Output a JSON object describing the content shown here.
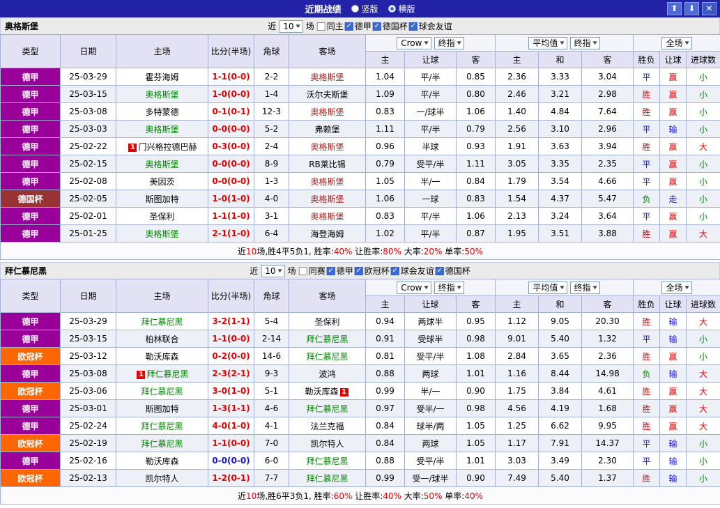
{
  "icons": {
    "dropdown_arrow": "▼",
    "check": "✓",
    "up_arrow": "⬆",
    "down_arrow": "⬇",
    "close": "✕"
  },
  "colors": {
    "red": "#e60000",
    "green": "#008800",
    "blue": "#1414cc",
    "black": "#000000",
    "team_red": "#aa2222",
    "team_green": "#008800"
  },
  "titlebar": {
    "title": "近期战绩",
    "layout_vertical": "竖版",
    "layout_horizontal": "横版",
    "selected_layout": "横版"
  },
  "table_headers": {
    "type": "类型",
    "date": "日期",
    "home": "主场",
    "score": "比分(半场)",
    "corner": "角球",
    "away": "客场",
    "odds_home": "主",
    "odds_handicap": "让球",
    "odds_away": "客",
    "avg_home": "主",
    "avg_draw": "和",
    "avg_away": "客",
    "result": "胜负",
    "handicap_result": "让球",
    "goals": "进球数"
  },
  "sections": [
    {
      "team": "奥格斯堡",
      "filter": {
        "near": "近",
        "count": "10",
        "unit": "场",
        "checkboxes": [
          {
            "label": "同主",
            "checked": false
          },
          {
            "label": "德甲",
            "checked": true
          },
          {
            "label": "德国杯",
            "checked": true
          },
          {
            "label": "球会友谊",
            "checked": true
          }
        ]
      },
      "dropdowns": {
        "company": "Crow",
        "company_time": "终指",
        "avg": "平均值",
        "avg_time": "终指",
        "scope": "全场"
      },
      "rows": [
        {
          "league": "德甲",
          "league_bg": "#990099",
          "date": "25-03-29",
          "home": "霍芬海姆",
          "home_color": "black",
          "home_badge": "",
          "score": "1-1(0-0)",
          "score_color": "red",
          "corner": "2-2",
          "away": "奥格斯堡",
          "away_color": "team_red",
          "away_badge": "",
          "h_odds": "1.04",
          "handicap": "平/半",
          "a_odds": "0.85",
          "avg_h": "2.36",
          "avg_d": "3.33",
          "avg_a": "3.04",
          "result": "平",
          "result_color": "blue",
          "let_result": "赢",
          "let_color": "red",
          "goal": "小",
          "goal_color": "green"
        },
        {
          "league": "德甲",
          "league_bg": "#990099",
          "date": "25-03-15",
          "home": "奥格斯堡",
          "home_color": "team_green",
          "home_badge": "",
          "score": "1-0(0-0)",
          "score_color": "red",
          "corner": "1-4",
          "away": "沃尔夫斯堡",
          "away_color": "black",
          "away_badge": "",
          "h_odds": "1.09",
          "handicap": "平/半",
          "a_odds": "0.80",
          "avg_h": "2.46",
          "avg_d": "3.21",
          "avg_a": "2.98",
          "result": "胜",
          "result_color": "red",
          "let_result": "赢",
          "let_color": "red",
          "goal": "小",
          "goal_color": "green"
        },
        {
          "league": "德甲",
          "league_bg": "#990099",
          "date": "25-03-08",
          "home": "多特蒙德",
          "home_color": "black",
          "home_badge": "",
          "score": "0-1(0-1)",
          "score_color": "red",
          "corner": "12-3",
          "away": "奥格斯堡",
          "away_color": "team_red",
          "away_badge": "",
          "h_odds": "0.83",
          "handicap": "一/球半",
          "a_odds": "1.06",
          "avg_h": "1.40",
          "avg_d": "4.84",
          "avg_a": "7.64",
          "result": "胜",
          "result_color": "red",
          "let_result": "赢",
          "let_color": "red",
          "goal": "小",
          "goal_color": "green"
        },
        {
          "league": "德甲",
          "league_bg": "#990099",
          "date": "25-03-03",
          "home": "奥格斯堡",
          "home_color": "team_green",
          "home_badge": "",
          "score": "0-0(0-0)",
          "score_color": "red",
          "corner": "5-2",
          "away": "弗赖堡",
          "away_color": "black",
          "away_badge": "",
          "h_odds": "1.11",
          "handicap": "平/半",
          "a_odds": "0.79",
          "avg_h": "2.56",
          "avg_d": "3.10",
          "avg_a": "2.96",
          "result": "平",
          "result_color": "blue",
          "let_result": "输",
          "let_color": "blue",
          "goal": "小",
          "goal_color": "green"
        },
        {
          "league": "德甲",
          "league_bg": "#990099",
          "date": "25-02-22",
          "home": "门兴格拉德巴赫",
          "home_color": "black",
          "home_badge": "1",
          "score": "0-3(0-0)",
          "score_color": "red",
          "corner": "2-4",
          "away": "奥格斯堡",
          "away_color": "team_red",
          "away_badge": "",
          "h_odds": "0.96",
          "handicap": "半球",
          "a_odds": "0.93",
          "avg_h": "1.91",
          "avg_d": "3.63",
          "avg_a": "3.94",
          "result": "胜",
          "result_color": "red",
          "let_result": "赢",
          "let_color": "red",
          "goal": "大",
          "goal_color": "red"
        },
        {
          "league": "德甲",
          "league_bg": "#990099",
          "date": "25-02-15",
          "home": "奥格斯堡",
          "home_color": "team_green",
          "home_badge": "",
          "score": "0-0(0-0)",
          "score_color": "red",
          "corner": "8-9",
          "away": "RB莱比锡",
          "away_color": "black",
          "away_badge": "",
          "h_odds": "0.79",
          "handicap": "受平/半",
          "a_odds": "1.11",
          "avg_h": "3.05",
          "avg_d": "3.35",
          "avg_a": "2.35",
          "result": "平",
          "result_color": "blue",
          "let_result": "赢",
          "let_color": "red",
          "goal": "小",
          "goal_color": "green"
        },
        {
          "league": "德甲",
          "league_bg": "#990099",
          "date": "25-02-08",
          "home": "美因茨",
          "home_color": "black",
          "home_badge": "",
          "score": "0-0(0-0)",
          "score_color": "red",
          "corner": "1-3",
          "away": "奥格斯堡",
          "away_color": "team_red",
          "away_badge": "",
          "h_odds": "1.05",
          "handicap": "半/一",
          "a_odds": "0.84",
          "avg_h": "1.79",
          "avg_d": "3.54",
          "avg_a": "4.66",
          "result": "平",
          "result_color": "blue",
          "let_result": "赢",
          "let_color": "red",
          "goal": "小",
          "goal_color": "green"
        },
        {
          "league": "德国杯",
          "league_bg": "#993333",
          "date": "25-02-05",
          "home": "斯图加特",
          "home_color": "black",
          "home_badge": "",
          "score": "1-0(1-0)",
          "score_color": "red",
          "corner": "4-0",
          "away": "奥格斯堡",
          "away_color": "team_red",
          "away_badge": "",
          "h_odds": "1.06",
          "handicap": "一球",
          "a_odds": "0.83",
          "avg_h": "1.54",
          "avg_d": "4.37",
          "avg_a": "5.47",
          "result": "负",
          "result_color": "green",
          "let_result": "走",
          "let_color": "blue",
          "goal": "小",
          "goal_color": "green"
        },
        {
          "league": "德甲",
          "league_bg": "#990099",
          "date": "25-02-01",
          "home": "圣保利",
          "home_color": "black",
          "home_badge": "",
          "score": "1-1(1-0)",
          "score_color": "red",
          "corner": "3-1",
          "away": "奥格斯堡",
          "away_color": "team_red",
          "away_badge": "",
          "h_odds": "0.83",
          "handicap": "平/半",
          "a_odds": "1.06",
          "avg_h": "2.13",
          "avg_d": "3.24",
          "avg_a": "3.64",
          "result": "平",
          "result_color": "blue",
          "let_result": "赢",
          "let_color": "red",
          "goal": "小",
          "goal_color": "green"
        },
        {
          "league": "德甲",
          "league_bg": "#990099",
          "date": "25-01-25",
          "home": "奥格斯堡",
          "home_color": "team_green",
          "home_badge": "",
          "score": "2-1(1-0)",
          "score_color": "red",
          "corner": "6-4",
          "away": "海登海姆",
          "away_color": "black",
          "away_badge": "",
          "h_odds": "1.02",
          "handicap": "平/半",
          "a_odds": "0.87",
          "avg_h": "1.95",
          "avg_d": "3.51",
          "avg_a": "3.88",
          "result": "胜",
          "result_color": "red",
          "let_result": "赢",
          "let_color": "red",
          "goal": "大",
          "goal_color": "red"
        }
      ],
      "summary_segments": [
        {
          "text": "近",
          "color": "black"
        },
        {
          "text": "10",
          "color": "red"
        },
        {
          "text": "场,胜4平5负1, 胜率:",
          "color": "black"
        },
        {
          "text": "40%",
          "color": "red"
        },
        {
          "text": " 让胜率:",
          "color": "black"
        },
        {
          "text": "80%",
          "color": "red"
        },
        {
          "text": " 大率:",
          "color": "black"
        },
        {
          "text": "20%",
          "color": "red"
        },
        {
          "text": " 单率:",
          "color": "black"
        },
        {
          "text": "50%",
          "color": "red"
        }
      ]
    },
    {
      "team": "拜仁慕尼黑",
      "filter": {
        "near": "近",
        "count": "10",
        "unit": "场",
        "checkboxes": [
          {
            "label": "同赛",
            "checked": false
          },
          {
            "label": "德甲",
            "checked": true
          },
          {
            "label": "欧冠杯",
            "checked": true
          },
          {
            "label": "球会友谊",
            "checked": true
          },
          {
            "label": "德国杯",
            "checked": true
          }
        ]
      },
      "dropdowns": {
        "company": "Crow",
        "company_time": "终指",
        "avg": "平均值",
        "avg_time": "终指",
        "scope": "全场"
      },
      "rows": [
        {
          "league": "德甲",
          "league_bg": "#990099",
          "date": "25-03-29",
          "home": "拜仁慕尼黑",
          "home_color": "team_green",
          "home_badge": "",
          "score": "3-2(1-1)",
          "score_color": "red",
          "corner": "5-4",
          "away": "圣保利",
          "away_color": "black",
          "away_badge": "",
          "h_odds": "0.94",
          "handicap": "两球半",
          "a_odds": "0.95",
          "avg_h": "1.12",
          "avg_d": "9.05",
          "avg_a": "20.30",
          "result": "胜",
          "result_color": "red",
          "let_result": "输",
          "let_color": "blue",
          "goal": "大",
          "goal_color": "red"
        },
        {
          "league": "德甲",
          "league_bg": "#990099",
          "date": "25-03-15",
          "home": "柏林联合",
          "home_color": "black",
          "home_badge": "",
          "score": "1-1(0-0)",
          "score_color": "red",
          "corner": "2-14",
          "away": "拜仁慕尼黑",
          "away_color": "team_green",
          "away_badge": "",
          "h_odds": "0.91",
          "handicap": "受球半",
          "a_odds": "0.98",
          "avg_h": "9.01",
          "avg_d": "5.40",
          "avg_a": "1.32",
          "result": "平",
          "result_color": "blue",
          "let_result": "输",
          "let_color": "blue",
          "goal": "小",
          "goal_color": "green"
        },
        {
          "league": "欧冠杯",
          "league_bg": "#ff6600",
          "date": "25-03-12",
          "home": "勒沃库森",
          "home_color": "black",
          "home_badge": "",
          "score": "0-2(0-0)",
          "score_color": "red",
          "corner": "14-6",
          "away": "拜仁慕尼黑",
          "away_color": "team_green",
          "away_badge": "",
          "h_odds": "0.81",
          "handicap": "受平/半",
          "a_odds": "1.08",
          "avg_h": "2.84",
          "avg_d": "3.65",
          "avg_a": "2.36",
          "result": "胜",
          "result_color": "red",
          "let_result": "赢",
          "let_color": "red",
          "goal": "小",
          "goal_color": "green"
        },
        {
          "league": "德甲",
          "league_bg": "#990099",
          "date": "25-03-08",
          "home": "拜仁慕尼黑",
          "home_color": "team_green",
          "home_badge": "1",
          "score": "2-3(2-1)",
          "score_color": "red",
          "corner": "9-3",
          "away": "波鸿",
          "away_color": "black",
          "away_badge": "",
          "h_odds": "0.88",
          "handicap": "两球",
          "a_odds": "1.01",
          "avg_h": "1.16",
          "avg_d": "8.44",
          "avg_a": "14.98",
          "result": "负",
          "result_color": "green",
          "let_result": "输",
          "let_color": "blue",
          "goal": "大",
          "goal_color": "red"
        },
        {
          "league": "欧冠杯",
          "league_bg": "#ff6600",
          "date": "25-03-06",
          "home": "拜仁慕尼黑",
          "home_color": "team_green",
          "home_badge": "",
          "score": "3-0(1-0)",
          "score_color": "red",
          "corner": "5-1",
          "away": "勒沃库森",
          "away_color": "black",
          "away_badge": "1",
          "h_odds": "0.99",
          "handicap": "半/一",
          "a_odds": "0.90",
          "avg_h": "1.75",
          "avg_d": "3.84",
          "avg_a": "4.61",
          "result": "胜",
          "result_color": "red",
          "let_result": "赢",
          "let_color": "red",
          "goal": "大",
          "goal_color": "red"
        },
        {
          "league": "德甲",
          "league_bg": "#990099",
          "date": "25-03-01",
          "home": "斯图加特",
          "home_color": "black",
          "home_badge": "",
          "score": "1-3(1-1)",
          "score_color": "red",
          "corner": "4-6",
          "away": "拜仁慕尼黑",
          "away_color": "team_green",
          "away_badge": "",
          "h_odds": "0.97",
          "handicap": "受半/一",
          "a_odds": "0.98",
          "avg_h": "4.56",
          "avg_d": "4.19",
          "avg_a": "1.68",
          "result": "胜",
          "result_color": "red",
          "let_result": "赢",
          "let_color": "red",
          "goal": "大",
          "goal_color": "red"
        },
        {
          "league": "德甲",
          "league_bg": "#990099",
          "date": "25-02-24",
          "home": "拜仁慕尼黑",
          "home_color": "team_green",
          "home_badge": "",
          "score": "4-0(1-0)",
          "score_color": "red",
          "corner": "4-1",
          "away": "法兰克福",
          "away_color": "black",
          "away_badge": "",
          "h_odds": "0.84",
          "handicap": "球半/两",
          "a_odds": "1.05",
          "avg_h": "1.25",
          "avg_d": "6.62",
          "avg_a": "9.95",
          "result": "胜",
          "result_color": "red",
          "let_result": "赢",
          "let_color": "red",
          "goal": "大",
          "goal_color": "red"
        },
        {
          "league": "欧冠杯",
          "league_bg": "#ff6600",
          "date": "25-02-19",
          "home": "拜仁慕尼黑",
          "home_color": "team_green",
          "home_badge": "",
          "score": "1-1(0-0)",
          "score_color": "red",
          "corner": "7-0",
          "away": "凯尔特人",
          "away_color": "black",
          "away_badge": "",
          "h_odds": "0.84",
          "handicap": "两球",
          "a_odds": "1.05",
          "avg_h": "1.17",
          "avg_d": "7.91",
          "avg_a": "14.37",
          "result": "平",
          "result_color": "blue",
          "let_result": "输",
          "let_color": "blue",
          "goal": "小",
          "goal_color": "green"
        },
        {
          "league": "德甲",
          "league_bg": "#990099",
          "date": "25-02-16",
          "home": "勒沃库森",
          "home_color": "black",
          "home_badge": "",
          "score": "0-0(0-0)",
          "score_color": "blue",
          "corner": "6-0",
          "away": "拜仁慕尼黑",
          "away_color": "team_green",
          "away_badge": "",
          "h_odds": "0.88",
          "handicap": "受平/半",
          "a_odds": "1.01",
          "avg_h": "3.03",
          "avg_d": "3.49",
          "avg_a": "2.30",
          "result": "平",
          "result_color": "blue",
          "let_result": "输",
          "let_color": "blue",
          "goal": "小",
          "goal_color": "green"
        },
        {
          "league": "欧冠杯",
          "league_bg": "#ff6600",
          "date": "25-02-13",
          "home": "凯尔特人",
          "home_color": "black",
          "home_badge": "",
          "score": "1-2(0-1)",
          "score_color": "red",
          "corner": "7-7",
          "away": "拜仁慕尼黑",
          "away_color": "team_green",
          "away_badge": "",
          "h_odds": "0.99",
          "handicap": "受一/球半",
          "a_odds": "0.90",
          "avg_h": "7.49",
          "avg_d": "5.40",
          "avg_a": "1.37",
          "result": "胜",
          "result_color": "red",
          "let_result": "输",
          "let_color": "blue",
          "goal": "小",
          "goal_color": "green"
        }
      ],
      "summary_segments": [
        {
          "text": "近",
          "color": "black"
        },
        {
          "text": "10",
          "color": "red"
        },
        {
          "text": "场,胜6平3负1, 胜率:",
          "color": "black"
        },
        {
          "text": "60%",
          "color": "red"
        },
        {
          "text": " 让胜率:",
          "color": "black"
        },
        {
          "text": "40%",
          "color": "red"
        },
        {
          "text": " 大率:",
          "color": "black"
        },
        {
          "text": "50%",
          "color": "red"
        },
        {
          "text": " 单率:",
          "color": "black"
        },
        {
          "text": "40%",
          "color": "red"
        }
      ]
    }
  ]
}
